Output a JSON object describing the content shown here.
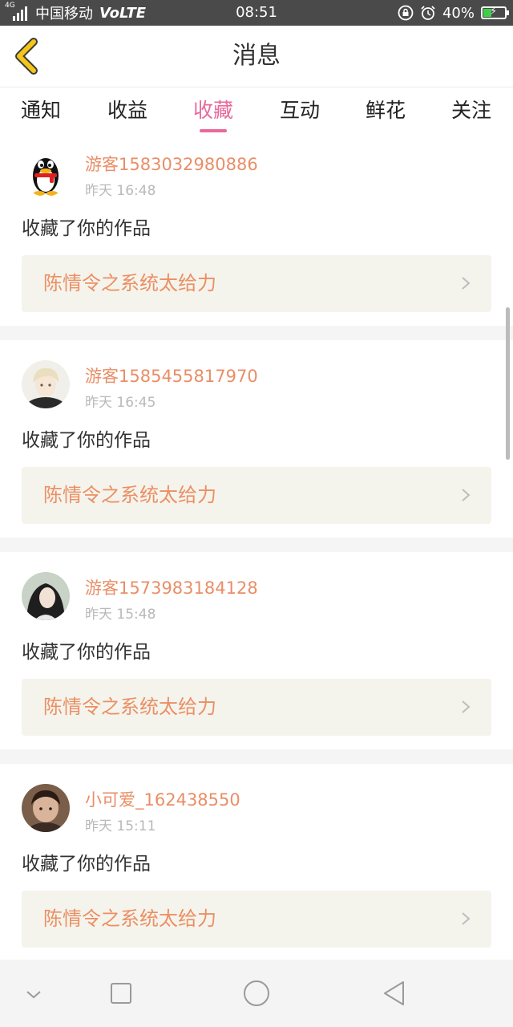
{
  "status_bar": {
    "network": "4G",
    "carrier": "中国移动",
    "volte": "VoLTE",
    "time": "08:51",
    "battery_text": "40%",
    "battery_level": 0.4,
    "icons": [
      "lock-rotation-icon",
      "alarm-icon",
      "battery-icon"
    ]
  },
  "header": {
    "title": "消息",
    "back_icon": "chevron-left-icon",
    "accent_color": "#f5c518"
  },
  "tabs": {
    "items": [
      "通知",
      "收益",
      "收藏",
      "互动",
      "鲜花",
      "关注"
    ],
    "active_index": 2,
    "active_color": "#e8699a"
  },
  "feed": [
    {
      "username": "游客1583032980886",
      "time": "昨天 16:48",
      "action": "收藏了你的作品",
      "work_title": "陈情令之系统太给力",
      "avatar": "qq-penguin-avatar"
    },
    {
      "username": "游客1585455817970",
      "time": "昨天 16:45",
      "action": "收藏了你的作品",
      "work_title": "陈情令之系统太给力",
      "avatar": "anime-boy-avatar"
    },
    {
      "username": "游客1573983184128",
      "time": "昨天 15:48",
      "action": "收藏了你的作品",
      "work_title": "陈情令之系统太给力",
      "avatar": "girl-photo-avatar"
    },
    {
      "username": "小可爱_162438550",
      "time": "昨天 15:11",
      "action": "收藏了你的作品",
      "work_title": "陈情令之系统太给力",
      "avatar": "child-photo-avatar"
    }
  ],
  "colors": {
    "username": "#e98e67",
    "work_title": "#ec8f63",
    "work_box_bg": "#f4f4ed"
  },
  "nav_bar": {
    "buttons": [
      "chevron-down-icon",
      "recent-apps-square-icon",
      "home-circle-icon",
      "back-triangle-icon"
    ]
  }
}
